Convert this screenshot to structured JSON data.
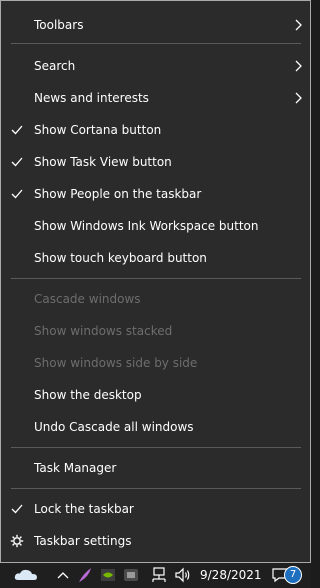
{
  "menu": {
    "items": [
      {
        "label": "Toolbars",
        "checked": false,
        "submenu": true,
        "disabled": false
      },
      {
        "label": "Search",
        "checked": false,
        "submenu": true,
        "disabled": false
      },
      {
        "label": "News and interests",
        "checked": false,
        "submenu": true,
        "disabled": false
      },
      {
        "label": "Show Cortana button",
        "checked": true,
        "submenu": false,
        "disabled": false
      },
      {
        "label": "Show Task View button",
        "checked": true,
        "submenu": false,
        "disabled": false
      },
      {
        "label": "Show People on the taskbar",
        "checked": true,
        "submenu": false,
        "disabled": false
      },
      {
        "label": "Show Windows Ink Workspace button",
        "checked": false,
        "submenu": false,
        "disabled": false
      },
      {
        "label": "Show touch keyboard button",
        "checked": false,
        "submenu": false,
        "disabled": false
      },
      {
        "label": "Cascade windows",
        "checked": false,
        "submenu": false,
        "disabled": true
      },
      {
        "label": "Show windows stacked",
        "checked": false,
        "submenu": false,
        "disabled": true
      },
      {
        "label": "Show windows side by side",
        "checked": false,
        "submenu": false,
        "disabled": true
      },
      {
        "label": "Show the desktop",
        "checked": false,
        "submenu": false,
        "disabled": false
      },
      {
        "label": "Undo Cascade all windows",
        "checked": false,
        "submenu": false,
        "disabled": false
      },
      {
        "label": "Task Manager",
        "checked": false,
        "submenu": false,
        "disabled": false
      },
      {
        "label": "Lock the taskbar",
        "checked": true,
        "submenu": false,
        "disabled": false
      },
      {
        "label": "Taskbar settings",
        "checked": false,
        "submenu": false,
        "disabled": false,
        "icon": "gear-icon"
      }
    ]
  },
  "taskbar": {
    "date": "9/28/2021",
    "notification_count": "7"
  },
  "colors": {
    "menu_background": "#2b2b2b",
    "text": "#ffffff",
    "disabled_text": "#6d6d6d",
    "separator": "#5a5a5a",
    "badge": "#1f6fbf"
  }
}
